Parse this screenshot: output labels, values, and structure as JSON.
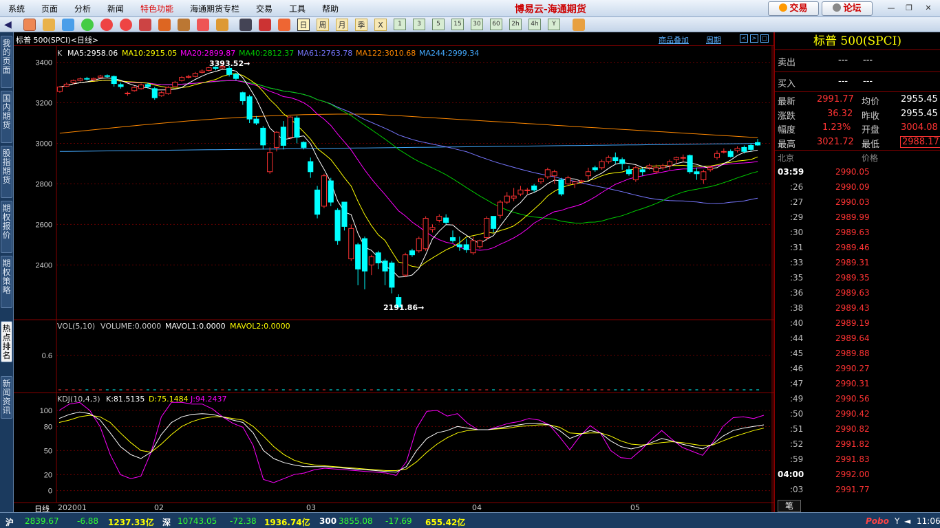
{
  "menu": [
    "系统",
    "页面",
    "分析",
    "新闻",
    "特色功能",
    "海通期货专栏",
    "交易",
    "工具",
    "帮助"
  ],
  "app_title": "博易云-海通期货",
  "top_buttons": {
    "trade": "交易",
    "forum": "论坛"
  },
  "toolbar_periods": [
    "日",
    "周",
    "月",
    "季",
    "X",
    "1",
    "3",
    "5",
    "15",
    "30",
    "60",
    "2h",
    "4h",
    "Y"
  ],
  "left_tabs": [
    "我的页面",
    "国内期货",
    "股指期货",
    "期权报价",
    "期权策略",
    "热点排名",
    "新闻资讯"
  ],
  "chart_header": {
    "title": "标普 500(SPCI)<日线>",
    "link1": "商品叠加",
    "link2": "周期"
  },
  "price_legend": {
    "k": "K",
    "ma5": "MA5:2958.06",
    "ma10": "MA10:2915.05",
    "ma20": "MA20:2899.87",
    "ma40": "MA40:2812.37",
    "ma61": "MA61:2763.78",
    "ma122": "MA122:3010.68",
    "ma244": "MA244:2999.34"
  },
  "vol_legend": {
    "vol": "VOL(5,10)",
    "volume": "VOLUME:0.0000",
    "mavol1": "MAVOL1:0.0000",
    "mavol2": "MAVOL2:0.0000"
  },
  "kdj_legend": {
    "kdj": "KDJ(10,4,3)",
    "k": "K:81.5135",
    "d": "D:75.1484",
    "j": "J:94.2437"
  },
  "annotations": {
    "high": "3393.52",
    "low": "2191.86"
  },
  "x_axis": {
    "period_label": "日线",
    "date_labels": [
      "202001",
      "02",
      "03",
      "04",
      "05"
    ]
  },
  "colors": {
    "up": "#ff3232",
    "down": "#00ffff",
    "ma5": "#ffffff",
    "ma10": "#ffff00",
    "ma20": "#ff00ff",
    "ma40": "#00cc00",
    "ma61": "#7777ff",
    "ma122": "#ff8800",
    "ma244": "#44aaff"
  },
  "chart_data": {
    "type": "candlestick",
    "y_ticks_price": [
      3400,
      3200,
      3000,
      2800,
      2600,
      2400
    ],
    "y_ticks_vol": [
      "0.6"
    ],
    "y_ticks_kdj": [
      100,
      80,
      50,
      20,
      0
    ],
    "candles": [
      [
        3256,
        3278,
        3250,
        3283
      ],
      [
        3282,
        3292,
        3278,
        3300
      ],
      [
        3300,
        3310,
        3292,
        3315
      ],
      [
        3310,
        3318,
        3305,
        3325
      ],
      [
        3320,
        3318,
        3310,
        3328
      ],
      [
        3314,
        3320,
        3308,
        3325
      ],
      [
        3325,
        3332,
        3320,
        3338
      ],
      [
        3334,
        3330,
        3325,
        3340
      ],
      [
        3330,
        3295,
        3280,
        3335
      ],
      [
        3290,
        3280,
        3270,
        3300
      ],
      [
        3245,
        3248,
        3235,
        3255
      ],
      [
        3260,
        3276,
        3255,
        3282
      ],
      [
        3270,
        3288,
        3265,
        3295
      ],
      [
        3290,
        3280,
        3270,
        3298
      ],
      [
        3270,
        3225,
        3215,
        3278
      ],
      [
        3235,
        3250,
        3230,
        3258
      ],
      [
        3245,
        3276,
        3240,
        3282
      ],
      [
        3280,
        3302,
        3278,
        3308
      ],
      [
        3310,
        3325,
        3305,
        3332
      ],
      [
        3326,
        3330,
        3320,
        3338
      ],
      [
        3330,
        3345,
        3325,
        3352
      ],
      [
        3350,
        3357,
        3345,
        3365
      ],
      [
        3360,
        3373,
        3355,
        3378
      ],
      [
        3376,
        3370,
        3360,
        3380
      ],
      [
        3372,
        3380,
        3368,
        3393.52
      ],
      [
        3370,
        3340,
        3330,
        3382
      ],
      [
        3340,
        3320,
        3310,
        3348
      ],
      [
        3250,
        3210,
        3190,
        3255
      ],
      [
        3230,
        3120,
        3100,
        3240
      ],
      [
        3120,
        3100,
        3090,
        3135
      ],
      [
        3075,
        2992,
        2970,
        3085
      ],
      [
        2860,
        2955,
        2850,
        2980
      ],
      [
        2980,
        3055,
        2960,
        3060
      ],
      [
        3080,
        2990,
        2970,
        3110
      ],
      [
        3030,
        3130,
        3020,
        3135
      ],
      [
        3125,
        3030,
        3000,
        3136
      ],
      [
        3005,
        2980,
        2970,
        3010
      ],
      [
        2910,
        2860,
        2830,
        2930
      ],
      [
        2770,
        2650,
        2630,
        2790
      ],
      [
        2690,
        2840,
        2680,
        2850
      ],
      [
        2815,
        2710,
        2690,
        2830
      ],
      [
        2670,
        2520,
        2500,
        2680
      ],
      [
        2710,
        2590,
        2570,
        2710
      ],
      [
        2430,
        2580,
        2420,
        2600
      ],
      [
        2500,
        2380,
        2300,
        2510
      ],
      [
        2530,
        2370,
        2280,
        2540
      ],
      [
        2400,
        2440,
        2350,
        2450
      ],
      [
        2460,
        2410,
        2380,
        2470
      ],
      [
        2420,
        2370,
        2300,
        2430
      ],
      [
        2410,
        2290,
        2260,
        2420
      ],
      [
        2240,
        2191.86,
        2191.86,
        2255
      ],
      [
        2350,
        2450,
        2340,
        2460
      ],
      [
        2470,
        2450,
        2440,
        2480
      ],
      [
        2470,
        2530,
        2460,
        2540
      ],
      [
        2480,
        2630,
        2470,
        2640
      ],
      [
        2575,
        2585,
        2560,
        2600
      ],
      [
        2620,
        2640,
        2610,
        2650
      ],
      [
        2632,
        2610,
        2600,
        2650
      ],
      [
        2535,
        2520,
        2510,
        2570
      ],
      [
        2500,
        2490,
        2470,
        2540
      ],
      [
        2500,
        2475,
        2460,
        2530
      ],
      [
        2460,
        2520,
        2450,
        2540
      ],
      [
        2490,
        2520,
        2480,
        2525
      ],
      [
        2535,
        2630,
        2520,
        2640
      ],
      [
        2640,
        2580,
        2560,
        2640
      ],
      [
        2645,
        2710,
        2630,
        2720
      ],
      [
        2710,
        2740,
        2700,
        2760
      ],
      [
        2730,
        2740,
        2715,
        2780
      ],
      [
        2750,
        2770,
        2740,
        2790
      ],
      [
        2770,
        2770,
        2750,
        2780
      ],
      [
        2790,
        2770,
        2760,
        2800
      ],
      [
        2810,
        2825,
        2800,
        2830
      ],
      [
        2835,
        2870,
        2825,
        2880
      ],
      [
        2840,
        2860,
        2800,
        2870
      ],
      [
        2820,
        2750,
        2740,
        2830
      ],
      [
        2800,
        2830,
        2790,
        2840
      ],
      [
        2800,
        2810,
        2780,
        2815
      ],
      [
        2810,
        2815,
        2800,
        2820
      ],
      [
        2840,
        2860,
        2820,
        2880
      ],
      [
        2880,
        2870,
        2860,
        2890
      ],
      [
        2880,
        2910,
        2870,
        2920
      ],
      [
        2910,
        2930,
        2900,
        2940
      ],
      [
        2930,
        2915,
        2900,
        2955
      ],
      [
        2920,
        2900,
        2870,
        2930
      ],
      [
        2870,
        2850,
        2840,
        2890
      ],
      [
        2820,
        2880,
        2810,
        2890
      ],
      [
        2870,
        2860,
        2840,
        2880
      ],
      [
        2880,
        2890,
        2870,
        2900
      ],
      [
        2860,
        2880,
        2850,
        2895
      ],
      [
        2880,
        2890,
        2870,
        2900
      ],
      [
        2890,
        2910,
        2870,
        2920
      ],
      [
        2920,
        2930,
        2900,
        2935
      ],
      [
        2930,
        2930,
        2910,
        2945
      ],
      [
        2940,
        2860,
        2850,
        2945
      ],
      [
        2860,
        2850,
        2820,
        2880
      ],
      [
        2820,
        2860,
        2800,
        2870
      ],
      [
        2870,
        2880,
        2860,
        2890
      ],
      [
        2930,
        2950,
        2920,
        2965
      ],
      [
        2960,
        2960,
        2950,
        2975
      ],
      [
        2960,
        2935,
        2930,
        2970
      ],
      [
        2965,
        2975,
        2955,
        2985
      ],
      [
        2980,
        2960,
        2950,
        2990
      ],
      [
        2990,
        2970,
        2960,
        3000
      ],
      [
        3004.08,
        2991.77,
        2988.17,
        3021.72
      ]
    ],
    "kdj": {
      "k": [
        90,
        95,
        98,
        96,
        88,
        72,
        55,
        45,
        40,
        48,
        70,
        85,
        92,
        95,
        96,
        95,
        92,
        88,
        85,
        72,
        50,
        40,
        35,
        32,
        30,
        30,
        30,
        29,
        28,
        27,
        26,
        25,
        24,
        23,
        30,
        50,
        65,
        72,
        75,
        80,
        78,
        76,
        76,
        78,
        80,
        82,
        84,
        84,
        82,
        75,
        65,
        70,
        75,
        72,
        62,
        55,
        52,
        55,
        60,
        65,
        62,
        58,
        55,
        52,
        58,
        68,
        75,
        78,
        80,
        82
      ],
      "d": [
        85,
        88,
        92,
        94,
        92,
        85,
        72,
        60,
        50,
        48,
        58,
        70,
        80,
        86,
        90,
        92,
        92,
        90,
        88,
        80,
        68,
        55,
        45,
        38,
        34,
        32,
        31,
        30,
        29,
        28,
        27,
        26,
        25,
        25,
        27,
        36,
        48,
        58,
        66,
        72,
        75,
        76,
        76,
        77,
        78,
        80,
        81,
        82,
        82,
        79,
        72,
        71,
        72,
        72,
        68,
        62,
        58,
        57,
        58,
        60,
        61,
        60,
        58,
        56,
        57,
        62,
        67,
        71,
        75,
        78
      ],
      "j": [
        100,
        108,
        110,
        100,
        80,
        45,
        20,
        15,
        18,
        48,
        92,
        110,
        110,
        108,
        108,
        102,
        92,
        84,
        79,
        56,
        14,
        10,
        15,
        20,
        22,
        26,
        28,
        27,
        26,
        25,
        24,
        23,
        22,
        19,
        36,
        78,
        99,
        100,
        93,
        96,
        84,
        76,
        76,
        80,
        84,
        86,
        90,
        88,
        82,
        67,
        51,
        68,
        81,
        72,
        50,
        41,
        40,
        51,
        64,
        75,
        64,
        54,
        49,
        44,
        60,
        80,
        91,
        92,
        90,
        94
      ]
    }
  },
  "quote": {
    "title": "标普 500(SPCI)",
    "sell_label": "卖出",
    "sell_price": "---",
    "sell_vol": "---",
    "buy_label": "买入",
    "buy_price": "---",
    "buy_vol": "---",
    "rows": [
      {
        "l1": "最新",
        "v1": "2991.77",
        "l2": "均价",
        "v2": "2955.45"
      },
      {
        "l1": "涨跌",
        "v1": "36.32",
        "l2": "昨收",
        "v2": "2955.45"
      },
      {
        "l1": "幅度",
        "v1": "1.23%",
        "l2": "开盘",
        "v2": "3004.08"
      },
      {
        "l1": "最高",
        "v1": "3021.72",
        "l2": "最低",
        "v2": "2988.17"
      }
    ],
    "tick_header": {
      "time": "北京",
      "price": "价格"
    },
    "ticks": [
      [
        "03:59",
        "2990.05"
      ],
      [
        ":26",
        "2990.09"
      ],
      [
        ":27",
        "2990.03"
      ],
      [
        ":29",
        "2989.99"
      ],
      [
        ":30",
        "2989.63"
      ],
      [
        ":31",
        "2989.46"
      ],
      [
        ":33",
        "2989.31"
      ],
      [
        ":35",
        "2989.35"
      ],
      [
        ":36",
        "2989.63"
      ],
      [
        ":38",
        "2989.43"
      ],
      [
        ":40",
        "2989.19"
      ],
      [
        ":44",
        "2989.64"
      ],
      [
        ":45",
        "2989.88"
      ],
      [
        ":46",
        "2990.27"
      ],
      [
        ":47",
        "2990.31"
      ],
      [
        ":49",
        "2990.56"
      ],
      [
        ":50",
        "2990.42"
      ],
      [
        ":51",
        "2990.82"
      ],
      [
        ":52",
        "2991.82"
      ],
      [
        ":59",
        "2991.83"
      ],
      [
        "04:00",
        "2992.00"
      ],
      [
        ":03",
        "2991.77"
      ]
    ],
    "tab": "笔"
  },
  "status": {
    "sh_label": "沪",
    "sh_index": "2839.67",
    "sh_chg": "-6.88",
    "sh_amt": "1237.33亿",
    "sz_label": "深",
    "sz_index": "10743.05",
    "sz_chg": "-72.38",
    "sz_amt": "1936.74亿",
    "hs_label": "300",
    "hs_index": "3855.08",
    "hs_chg": "-17.69",
    "hs_amt": "655.42亿",
    "brand": "Pobo",
    "time": "11:06"
  }
}
